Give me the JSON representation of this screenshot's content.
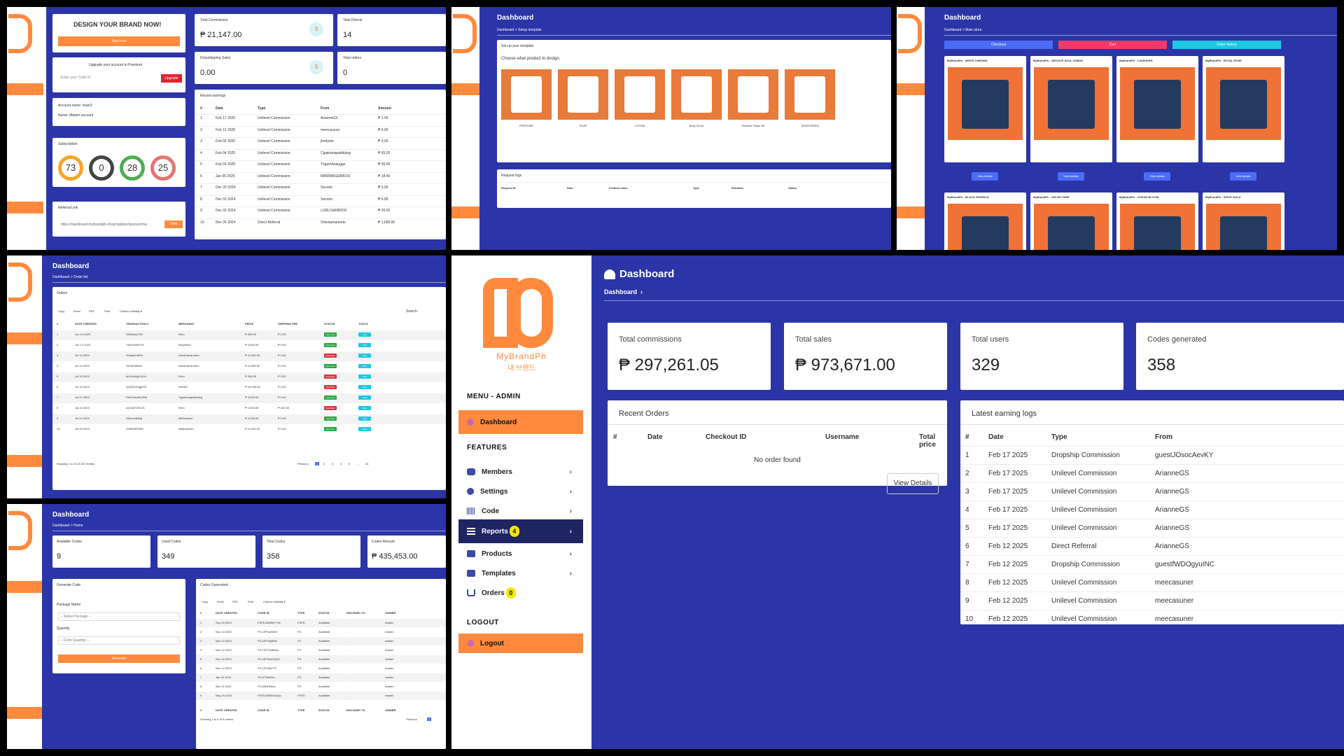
{
  "panel_tl": {
    "brand_title": "DESIGN YOUR BRAND NOW!",
    "start_btn": "Start now",
    "upgrade_text": "Upgrade your account to Premium.",
    "code_placeholder": "Enter your Code ID",
    "upgrade_btn": "Upgrade",
    "account_name": "Account name: main3",
    "account_type": "Name: Master account",
    "subscription": "Subscription",
    "circles": [
      "73",
      "0",
      "28",
      "25"
    ],
    "referral": "Referral Link",
    "referral_url": "https://dashboard.mybrandph.shop/register/sponsor/ma",
    "view_btn": "View",
    "total_commission_lbl": "Total Commission",
    "total_commission": "₱ 21,147.00",
    "total_directs_lbl": "Total Directs",
    "total_directs": "14",
    "dropship_lbl": "Dropshipping Sales",
    "dropship": "0.00",
    "total_orders_lbl": "Total orders",
    "total_orders": "0",
    "recent_earnings": "Recent earnings",
    "earn_headers": [
      "#",
      "Date",
      "Type",
      "From",
      "Amount"
    ],
    "earn_rows": [
      [
        "1",
        "Feb 17 2025",
        "Unilevel Commission",
        "ArianneGS",
        "₱ 1.00"
      ],
      [
        "2",
        "Feb 12 2025",
        "Unilevel Commission",
        "meecasuner",
        "₱ 6.00"
      ],
      [
        "3",
        "Feb 03 2025",
        "Unilevel Commission",
        "jimdome",
        "₱ 3.00"
      ],
      [
        "4",
        "Feb 04 2025",
        "Unilevel Commission",
        "Cjpabsmapaltdulog",
        "₱ 65.20"
      ],
      [
        "5",
        "Feb 03 2025",
        "Unilevel Commission",
        "TrigarhAsauggs",
        "₱ 45.00"
      ],
      [
        "6",
        "Jan 06 2025",
        "Unilevel Commission",
        "MARIMASERIKOS",
        "₱ 18.40"
      ],
      [
        "7",
        "Dec 20 2024",
        "Unilevel Commission",
        "Secrets",
        "₱ 3.00"
      ],
      [
        "8",
        "Dec 02 2024",
        "Unilevel Commission",
        "Secrets",
        "₱ 6.00"
      ],
      [
        "9",
        "Dec 02 2024",
        "Unilevel Commission",
        "LORLISANRIOS",
        "₱ 20.00"
      ],
      [
        "10",
        "Nov 26 2024",
        "Direct Referral",
        "Orientamanents",
        "₱ 1,000.00"
      ]
    ]
  },
  "panel_tm": {
    "title": "Dashboard",
    "crumb": "Dashboard  >  Setup template",
    "setup": "Set-up your template",
    "choose": "Choose what product to design.",
    "products": [
      "PERFUME",
      "SOAP",
      "LOTION",
      "Body Scrub",
      "Perfume Tester Kit",
      "SUNSCREEN"
    ],
    "request_logs": "Request logs",
    "req_headers": [
      "Request ID",
      "Date",
      "Product name",
      "Type",
      "Remarks",
      "Status"
    ]
  },
  "panel_tr": {
    "title": "Dashboard",
    "crumb": "Dashboard  >  Main store",
    "checkout": "Checkout",
    "cart": "Cart",
    "history": "Order history",
    "items": [
      "MyBrandPh - WHITE CHROMA",
      "MyBrandPh - GROOVE SOUL LEMON",
      "MyBrandPh - LAVENDER",
      "MyBrandPh - ROYAL ROSE"
    ],
    "items2": [
      "MyBrandPh - BLACK SPARKLE",
      "MyBrandPh - VELVET DRIP",
      "MyBrandPh - OCEAN BLOOM",
      "MyBrandPh - SPICE GOLD"
    ],
    "view": "View details"
  },
  "panel_ml": {
    "title": "Dashboard",
    "crumb": "Dashboard  >  Order list",
    "orders": "Orders",
    "btns": [
      "Copy",
      "Excel",
      "PDF",
      "Print",
      "Column visibility ▾"
    ],
    "search": "Search:",
    "headers": [
      "#",
      "DATE CREATED",
      "TRANSACTION #",
      "MERCHANT",
      "PRICE",
      "SHIPPING FEE",
      "STATUS",
      "TOOLS"
    ],
    "rows": [
      [
        "1",
        "Jun 19 2023",
        "SZBfowj7339",
        "Elvin",
        "₱ 399.00",
        "₱ 0.00",
        "Approved"
      ],
      [
        "2",
        "Jun 13 2023",
        "YNcGrWRrYH",
        "barjoeluhf",
        "₱ 3,000.00",
        "₱ 0.00",
        "Approved"
      ],
      [
        "3",
        "Jul 14 2023",
        "ZdmgDmfDef",
        "Abndhamandren",
        "₱ 11,000.00",
        "₱ 0.00",
        "Declined"
      ],
      [
        "4",
        "Jul 14 2023",
        "SXrNkdBaen",
        "Abndhamandren",
        "₱ 11,650.00",
        "₱ 0.00",
        "Approved"
      ],
      [
        "5",
        "Jul 15 2023",
        "yKCkvNgUJoOx",
        "Elvin",
        "₱ 399.00",
        "₱ 0.00",
        "Declined"
      ],
      [
        "6",
        "Jul 18 2023",
        "QoQGvXAgpOS",
        "Elvin01",
        "₱ 16,000.00",
        "₱ 0.00",
        "Declined"
      ],
      [
        "7",
        "Jul 21 2023",
        "RbOHautrDORfe",
        "Cjpabsmapaltdulog",
        "₱ 3,000.00",
        "₱ 0.00",
        "Approved"
      ],
      [
        "8",
        "Jul 22 2023",
        "zxCuB7OEv7A",
        "Elvin",
        "₱ 2,294.00",
        "₱ 100.00",
        "Declined"
      ],
      [
        "9",
        "Jul 24 2023",
        "KWuhu3Bhdj",
        "MRdudoad",
        "₱ 4,250.00",
        "₱ 0.00",
        "Approved"
      ],
      [
        "10",
        "Jul 26 2023",
        "zSkBeBiPd3S",
        "wehpsbrolm",
        "₱ 11,500.00",
        "₱ 0.00",
        "Approved"
      ]
    ],
    "view": "View",
    "footer": "Showing 1 to 10 of 237 entries",
    "previous": "Previous",
    "pages": [
      "1",
      "2",
      "3",
      "4",
      "5",
      "...",
      "24"
    ]
  },
  "panel_bl": {
    "title": "Dashboard",
    "crumb": "Dashboard  >  Home",
    "available_lbl": "Available Codes",
    "available": "9",
    "used_lbl": "Used Codes",
    "used": "349",
    "total_lbl": "Total Codes",
    "total": "358",
    "amount_lbl": "Codes Amount",
    "amount": "₱ 435,453.00",
    "gen_code": "Generate Code",
    "pkg": "Package Name",
    "pkg_sel": "-- Select Package --",
    "qty": "Quantity",
    "qty_sel": "-- Code Quantity --",
    "gen_btn": "Generate",
    "codes_gen": "Codes Generated",
    "btns": [
      "Copy",
      "Excel",
      "PDF",
      "Print",
      "Column visibility ▾"
    ],
    "headers": [
      "#",
      "DATE CREATED",
      "CODE ID",
      "TYPE",
      "STATUS",
      "ENCODED TO",
      "OWNER"
    ],
    "rows": [
      [
        "1",
        "Sep 05 2023",
        "FSPD-6b6fMYY9s",
        "FSPD",
        "Available",
        "-",
        "master"
      ],
      [
        "2",
        "Nov 14 2023",
        "FS-1EPQzBtAH",
        "FS",
        "Available",
        "-",
        "master"
      ],
      [
        "3",
        "Nov 14 2023",
        "FS-1EFHUjBSk",
        "FS",
        "Available",
        "-",
        "master"
      ],
      [
        "4",
        "Nov 14 2023",
        "FS-1ISTGwBe0c",
        "FS",
        "Available",
        "-",
        "master"
      ],
      [
        "5",
        "Nov 14 2023",
        "FS-1EFDtuUGQU",
        "FS",
        "Available",
        "-",
        "master"
      ],
      [
        "6",
        "Nov 14 2023",
        "FS-1ST05a7TF",
        "FS",
        "Available",
        "-",
        "master"
      ],
      [
        "7",
        "Jan 16 2024",
        "FS-D7t5eDtrn",
        "FS",
        "Available",
        "-",
        "master"
      ],
      [
        "8",
        "Mar 13 2025",
        "FS-DB4HNrbc",
        "FS",
        "Available",
        "-",
        "master"
      ],
      [
        "9",
        "May 29 2024",
        "FSPD-B6SKAvuZp",
        "FSPD",
        "Available",
        "-",
        "master"
      ]
    ],
    "footer": "Showing 1 to 9 of 9 entries",
    "previous": "Previous",
    "page": "1"
  },
  "main": {
    "logo_text": "MyBrandPh",
    "logo_kr": "내 브랜드",
    "menu_admin": "MENU - ADMIN",
    "dashboard_item": "Dashboard",
    "features": "FEATURES",
    "members": "Members",
    "settings": "Settings",
    "code": "Code",
    "reports": "Reports",
    "reports_badge": "4",
    "products": "Products",
    "templates": "Templates",
    "orders": "Orders",
    "orders_badge": "0",
    "logout_sec": "LOGOUT",
    "logout": "Logout",
    "title": "Dashboard",
    "crumb": "Dashboard",
    "crumb_arrow": "›",
    "stats": [
      {
        "label": "Total commissions",
        "value": "₱ 297,261.05"
      },
      {
        "label": "Total sales",
        "value": "₱ 973,671.00"
      },
      {
        "label": "Total users",
        "value": "329"
      },
      {
        "label": "Codes generated",
        "value": "358"
      }
    ],
    "recent_orders": "Recent Orders",
    "ro_headers": [
      "#",
      "Date",
      "Checkout ID",
      "Username",
      "Total price"
    ],
    "no_order": "No order found",
    "view_details": "View Details",
    "logs_title": "Latest earning logs",
    "log_headers": [
      "#",
      "Date",
      "Type",
      "From"
    ],
    "logs": [
      [
        "1",
        "Feb 17 2025",
        "Dropship Commission",
        "guestJOsocAevKY"
      ],
      [
        "2",
        "Feb 17 2025",
        "Unilevel Commission",
        "ArianneGS"
      ],
      [
        "3",
        "Feb 17 2025",
        "Unilevel Commission",
        "ArianneGS"
      ],
      [
        "4",
        "Feb 17 2025",
        "Unilevel Commission",
        "ArianneGS"
      ],
      [
        "5",
        "Feb 17 2025",
        "Unilevel Commission",
        "ArianneGS"
      ],
      [
        "6",
        "Feb 12 2025",
        "Direct Referral",
        "ArianneGS"
      ],
      [
        "7",
        "Feb 12 2025",
        "Dropship Commission",
        "guestfWDOgyuINC"
      ],
      [
        "8",
        "Feb 12 2025",
        "Unilevel Commission",
        "meecasuner"
      ],
      [
        "9",
        "Feb 12 2025",
        "Unilevel Commission",
        "meecasuner"
      ],
      [
        "10",
        "Feb 12 2025",
        "Unilevel Commission",
        "meecasuner"
      ]
    ]
  },
  "colors": {
    "brand_orange": "#ff8a3d",
    "navy": "#2b35a8",
    "approved": "#28a745",
    "declined": "#dc3545",
    "badge_yellow": "#f5e600"
  }
}
